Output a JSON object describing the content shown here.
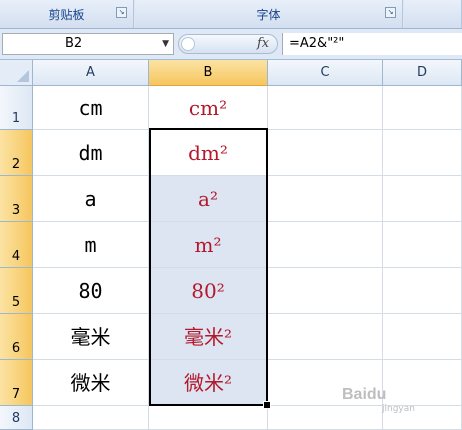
{
  "ribbon": {
    "groups": [
      {
        "label": "剪贴板"
      },
      {
        "label": "字体"
      }
    ]
  },
  "formula_bar": {
    "name_box": "B2",
    "fx_label": "fx",
    "formula": "=A2&\"²\""
  },
  "grid": {
    "columns": [
      "A",
      "B",
      "C",
      "D"
    ],
    "rows": [
      {
        "num": "1",
        "a": "cm",
        "b": "cm²"
      },
      {
        "num": "2",
        "a": "dm",
        "b": "dm²"
      },
      {
        "num": "3",
        "a": "a",
        "b": "a²"
      },
      {
        "num": "4",
        "a": "m",
        "b": "m²"
      },
      {
        "num": "5",
        "a": "80",
        "b": "80²"
      },
      {
        "num": "6",
        "a": "毫米",
        "b": "毫米²"
      },
      {
        "num": "7",
        "a": "微米",
        "b": "微米²"
      },
      {
        "num": "8",
        "a": "",
        "b": ""
      }
    ],
    "selected_column": "B",
    "selected_range": "B2:B7"
  },
  "watermark": {
    "text": "Baidu",
    "sub": "jingyan"
  },
  "colors": {
    "result_text": "#b3192a",
    "selection_shade": "#dde4f2",
    "header_selected": "#f6c65f"
  }
}
